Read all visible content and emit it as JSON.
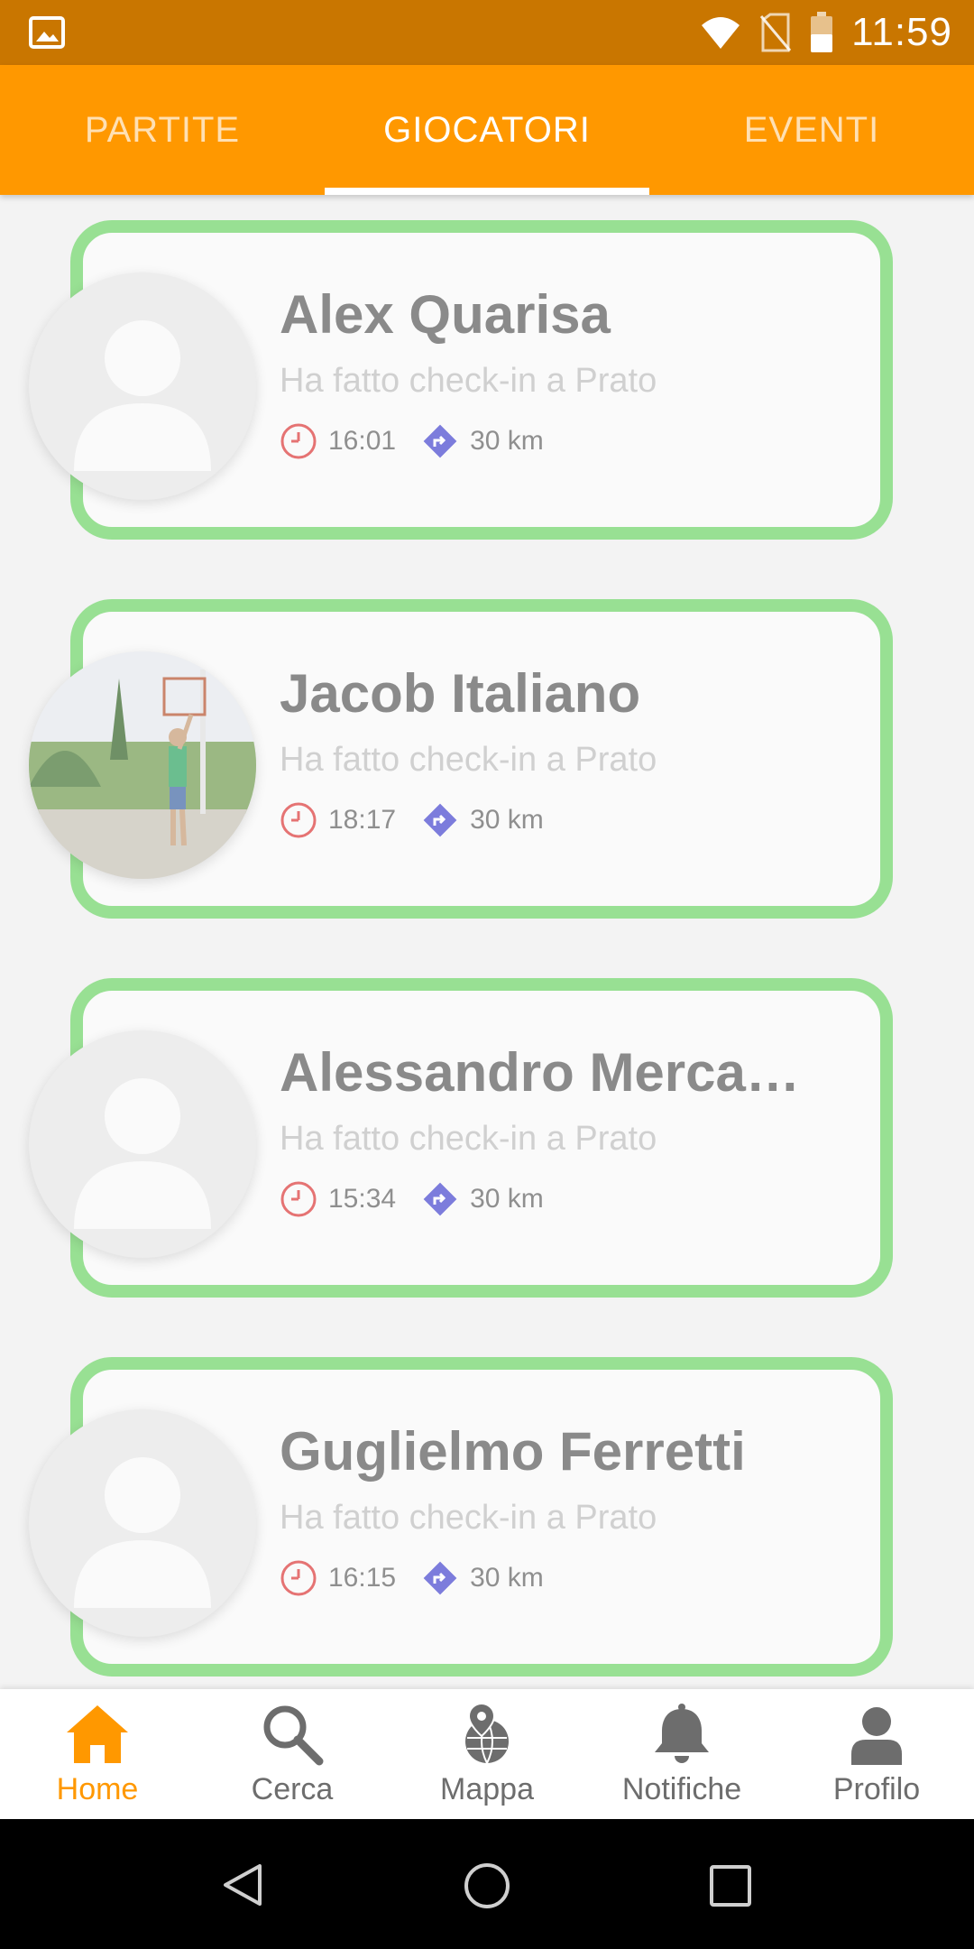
{
  "status_bar": {
    "time": "11:59"
  },
  "tabs": [
    {
      "label": "PARTITE",
      "selected": false
    },
    {
      "label": "GIOCATORI",
      "selected": true
    },
    {
      "label": "EVENTI",
      "selected": false
    }
  ],
  "players": [
    {
      "name": "Alex Quarisa",
      "status": "Ha fatto check-in a Prato",
      "time": "16:01",
      "distance": "30 km",
      "avatar": "placeholder"
    },
    {
      "name": "Jacob Italiano",
      "status": "Ha fatto check-in a Prato",
      "time": "18:17",
      "distance": "30 km",
      "avatar": "photo"
    },
    {
      "name": "Alessandro Merca…",
      "status": "Ha fatto check-in a Prato",
      "time": "15:34",
      "distance": "30 km",
      "avatar": "placeholder"
    },
    {
      "name": "Guglielmo Ferretti",
      "status": "Ha fatto check-in a Prato",
      "time": "16:15",
      "distance": "30 km",
      "avatar": "placeholder"
    }
  ],
  "bottom_nav": [
    {
      "label": "Home",
      "icon": "home-icon",
      "active": true
    },
    {
      "label": "Cerca",
      "icon": "search-icon",
      "active": false
    },
    {
      "label": "Mappa",
      "icon": "map-globe-icon",
      "active": false
    },
    {
      "label": "Notifiche",
      "icon": "bell-icon",
      "active": false
    },
    {
      "label": "Profilo",
      "icon": "profile-icon",
      "active": false
    }
  ],
  "colors": {
    "primary": "#ff9800",
    "status_bar": "#c97600",
    "card_border": "#98e093",
    "clock": "#e57373",
    "direction": "#7c7cdc"
  }
}
